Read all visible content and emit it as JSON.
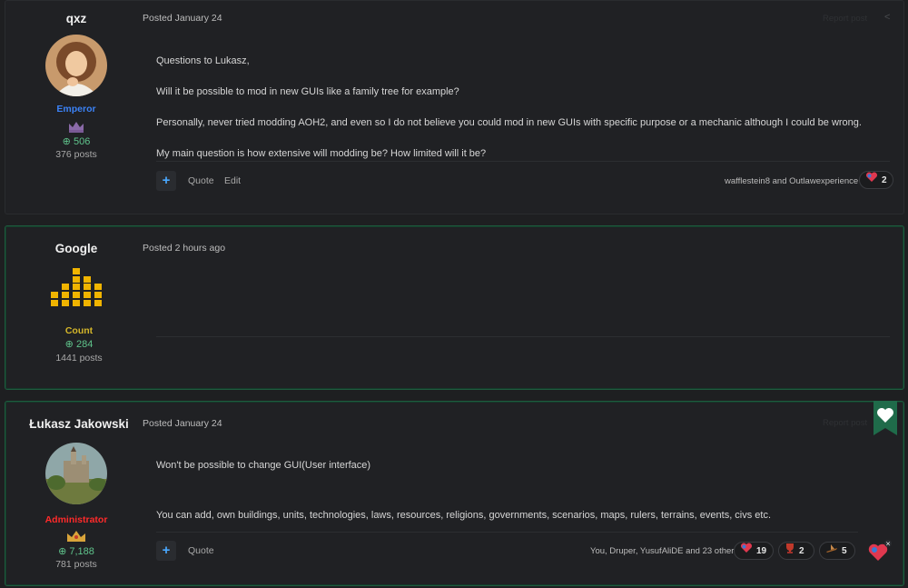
{
  "posts": [
    {
      "author": "qxz",
      "rank": "Emperor",
      "reputation": "506",
      "post_count": "376 posts",
      "posted": "Posted January 24",
      "report": "Report post",
      "content": [
        "Questions to Lukasz,",
        "Will it be possible to mod in new GUIs like a family tree for example?",
        "Personally, never tried modding AOH2, and even so I do not believe you could mod in new GUIs with specific purpose or a mechanic although I could be wrong.",
        "My main question is how extensive will modding be? How limited will it be?"
      ],
      "quote_label": "Quote",
      "edit_label": "Edit",
      "reacted_by": "wafflestein8 and Outlawexperience",
      "reaction_count": "2"
    },
    {
      "author": "Google",
      "rank": "Count",
      "reputation": "284",
      "post_count": "1441 posts",
      "posted": "Posted 2 hours ago"
    },
    {
      "author": "Łukasz Jakowski",
      "rank": "Administrator",
      "reputation": "7,188",
      "post_count": "781 posts",
      "posted": "Posted January 24",
      "report": "Report post",
      "content": [
        "Won't be possible to change GUI(User interface)",
        "You can add, own buildings, units, technologies, laws, resources, religions, governments, scenarios, maps, rulers, terrains, events, civs  etc."
      ],
      "quote_label": "Quote",
      "reacted_by": "You, Druper, YusufAliDE and 23 others",
      "reactions": [
        {
          "icon": "heart-reaction-icon",
          "count": "19"
        },
        {
          "icon": "trophy-reaction-icon",
          "count": "2"
        },
        {
          "icon": "ship-reaction-icon",
          "count": "5"
        }
      ]
    }
  ],
  "colors": {
    "emperor": "#3b82f6",
    "count": "#d4b62a",
    "administrator": "#ff2a2a",
    "reputation": "#5fc38b",
    "accent_green": "#1f6b4a"
  }
}
